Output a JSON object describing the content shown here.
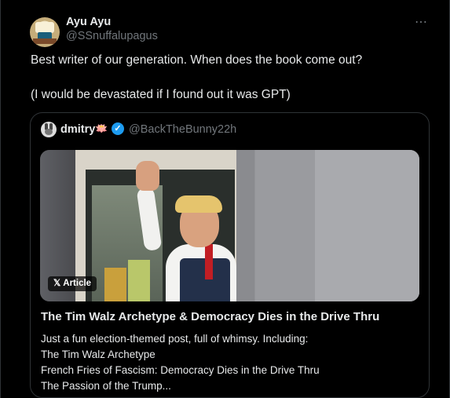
{
  "author": {
    "name": "Ayu Ayu",
    "handle": "@SSnuffalupagus"
  },
  "more_icon": "⋯",
  "text": {
    "line1": "Best writer of our generation. When does the book come out?",
    "line2": "(I would be devastated if I found out it was GPT)"
  },
  "quote": {
    "name": "dmitry",
    "emoji": "🪷",
    "verified": "✓",
    "handle": "@BackTheBunny",
    "separator": "·",
    "time": "22h",
    "badge": "Article",
    "title": "The Tim Walz Archetype & Democracy Dies in the Drive Thru",
    "description": [
      "Just a fun election-themed post, full of whimsy. Including:",
      "The Tim Walz Archetype",
      "French Fries of Fascism: Democracy Dies in the Drive Thru",
      "The Passion of the Trump..."
    ]
  }
}
